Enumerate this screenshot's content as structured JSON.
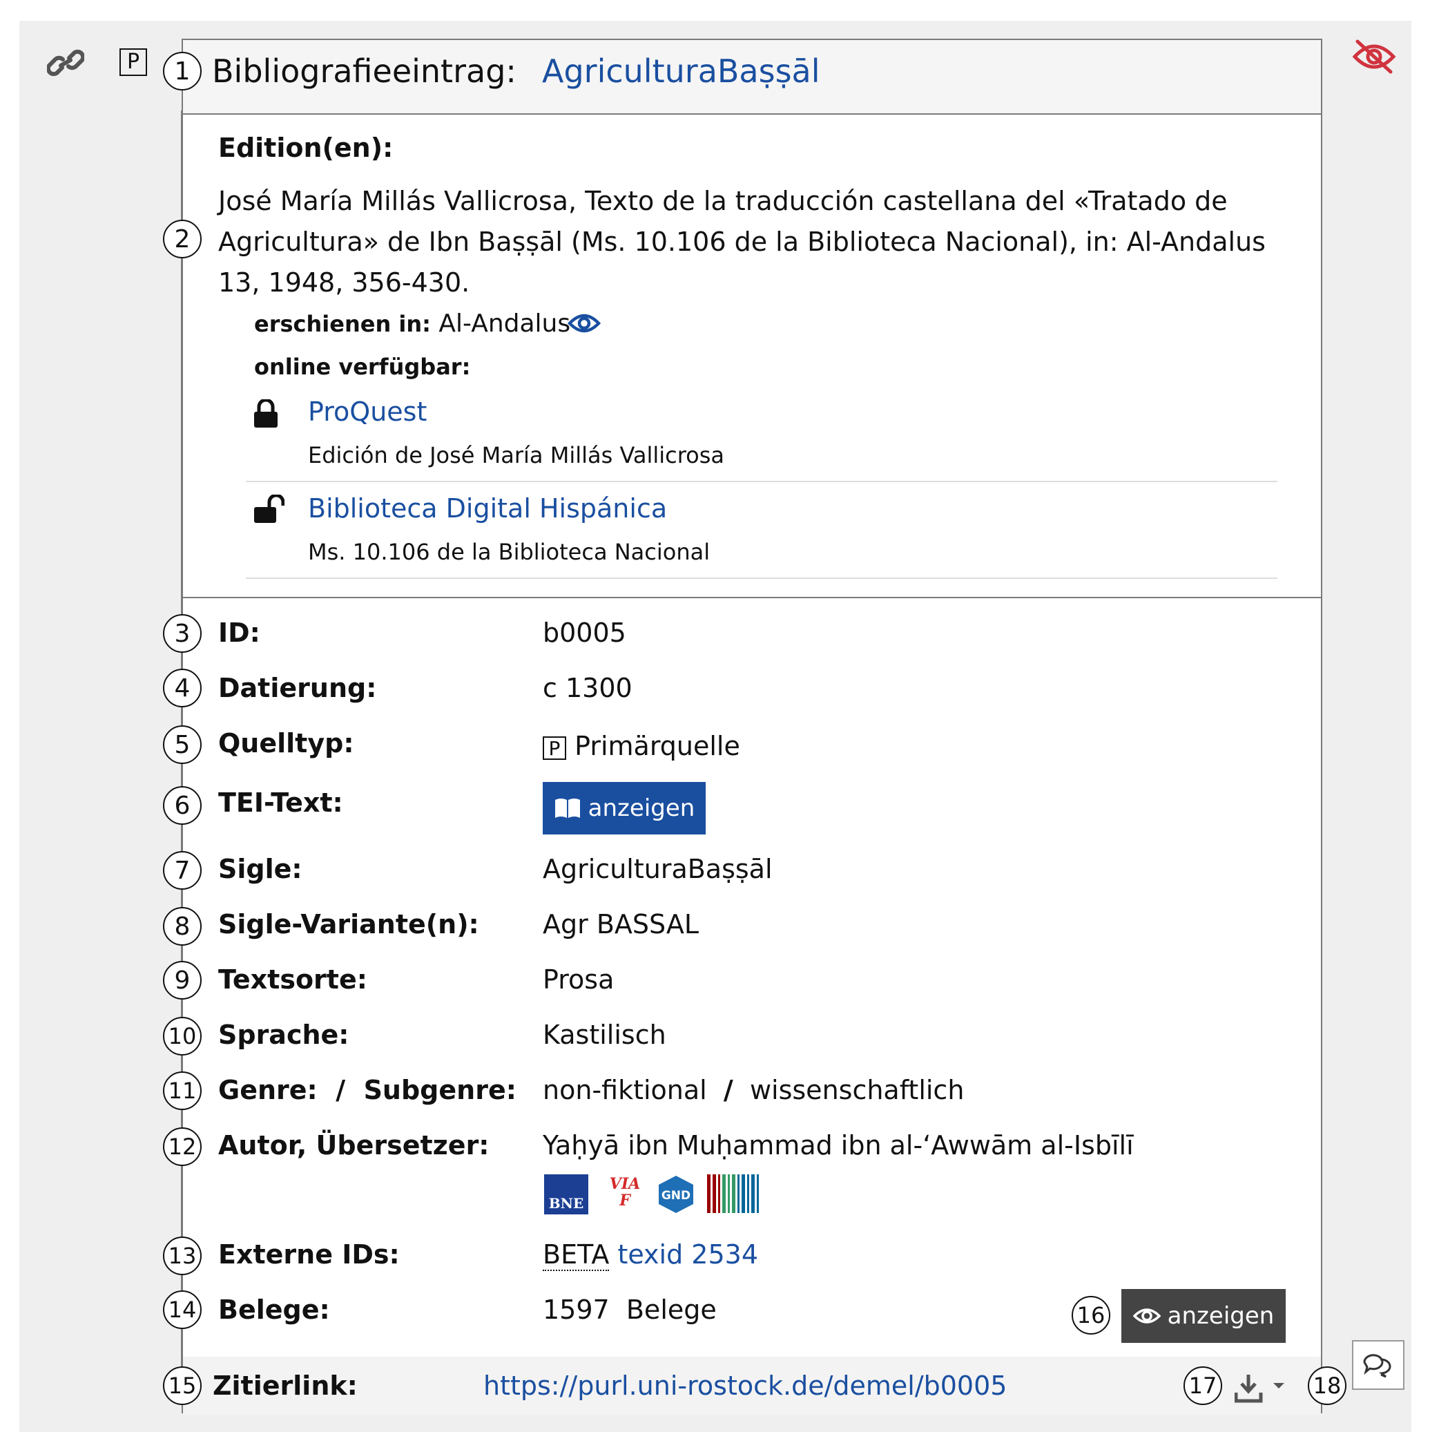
{
  "header": {
    "label": "Bibliografieeintrag:",
    "title": "AgriculturaBaṣṣāl"
  },
  "top_icons": {
    "link_icon": "link-icon",
    "source_type_badge": "P",
    "hide_icon": "eye-slash-icon"
  },
  "edition": {
    "heading": "Edition(en):",
    "text": "José María Millás Vallicrosa, Texto de la traducción castellana del «Tratado de Agricultura» de Ibn Baṣṣāl (Ms. 10.106 de la Biblioteca Nacional), in: Al-Andalus 13, 1948, 356-430.",
    "published_in_label": "erschienen in:",
    "published_in_value": "Al-Andalus",
    "online_label": "online verfügbar:",
    "online": [
      {
        "icon": "lock-icon",
        "title": "ProQuest",
        "subtitle": "Edición de José María Millás Vallicrosa"
      },
      {
        "icon": "unlock-icon",
        "title": "Biblioteca Digital Hispánica",
        "subtitle": "Ms. 10.106 de la Biblioteca Nacional"
      }
    ]
  },
  "fields": {
    "id_label": "ID:",
    "id_value": "b0005",
    "date_label": "Datierung:",
    "date_value": "c 1300",
    "type_label": "Quelltyp:",
    "type_badge": "P",
    "type_value": "Primärquelle",
    "tei_label": "TEI-Text:",
    "tei_button": "anzeigen",
    "sigle_label": "Sigle:",
    "sigle_value": "AgriculturaBaṣṣāl",
    "variant_label": "Sigle-Variante(n):",
    "variant_value": "Agr BASSAL",
    "textsorte_label": "Textsorte:",
    "textsorte_value": "Prosa",
    "sprache_label": "Sprache:",
    "sprache_value": "Kastilisch",
    "genre_label": "Genre:",
    "subgenre_label": "Subgenre:",
    "slash": "/",
    "genre_value": "non-fiktional",
    "subgenre_value": "wissenschaftlich",
    "author_label": "Autor, Übersetzer:",
    "author_value": "Yaḥyā ibn Muḥammad ibn al-‘Awwām al-Isbīlī",
    "authority": {
      "bne": "BNE",
      "viaf": "VIAF",
      "gnd": "GND"
    },
    "extern_label": "Externe IDs:",
    "extern_prefix": "BETA",
    "extern_link": "texid 2534",
    "belege_label": "Belege:",
    "belege_value": "1597  Belege",
    "belege_button": "anzeigen",
    "cite_label": "Zitierlink:",
    "cite_url": "https://purl.uni-rostock.de/demel/b0005"
  },
  "markers": [
    "1",
    "2",
    "3",
    "4",
    "5",
    "6",
    "7",
    "8",
    "9",
    "10",
    "11",
    "12",
    "13",
    "14",
    "15",
    "16",
    "17",
    "18"
  ],
  "colors": {
    "link": "#1a4fa0",
    "button_primary": "#1a4fa0",
    "button_dark": "#444444",
    "hide_icon": "#d0343f"
  }
}
